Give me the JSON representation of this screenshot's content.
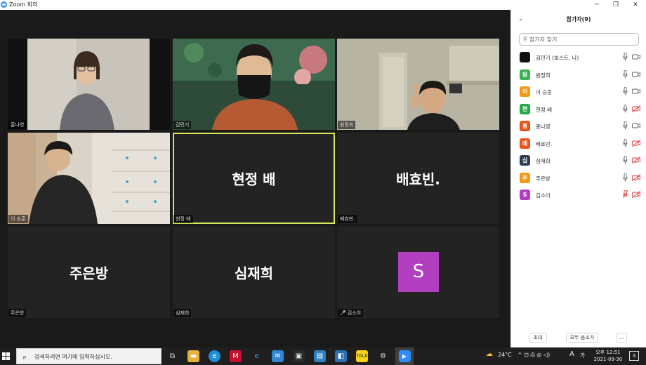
{
  "window": {
    "title": "Zoom 회의",
    "minimize": "─",
    "restore": "❐",
    "close": "✕"
  },
  "tiles": [
    {
      "id": "t1",
      "caption": "홍나영",
      "kind": "video"
    },
    {
      "id": "t2",
      "caption": "김민기",
      "kind": "video"
    },
    {
      "id": "t3",
      "caption": "원정희",
      "kind": "video"
    },
    {
      "id": "t4",
      "caption": "이 승훈",
      "kind": "video"
    },
    {
      "id": "t5",
      "caption": "현정 배",
      "display": "현정 배",
      "kind": "name",
      "active": true
    },
    {
      "id": "t6",
      "caption": "배효빈.",
      "display": "배효빈.",
      "kind": "name"
    },
    {
      "id": "t7",
      "caption": "주은방",
      "display": "주은방",
      "kind": "name"
    },
    {
      "id": "t8",
      "caption": "심재희",
      "display": "심재희",
      "kind": "name"
    },
    {
      "id": "t9",
      "caption": "김소이",
      "display": "S",
      "kind": "avatar",
      "muted": true,
      "avatar_color": "#b23fc0"
    }
  ],
  "panel": {
    "title": "참가자(9)",
    "search_placeholder": "참가자 찾기",
    "participants": [
      {
        "name": "김민기 (호스트, 나)",
        "initial": "",
        "color": "#111111",
        "mic": "on",
        "cam": "on"
      },
      {
        "name": "원정희",
        "initial": "원",
        "color": "#3cb054",
        "mic": "on",
        "cam": "on"
      },
      {
        "name": "이 승훈",
        "initial": "이",
        "color": "#f29a18",
        "mic": "on",
        "cam": "on"
      },
      {
        "name": "현정 배",
        "initial": "현",
        "color": "#26a84b",
        "mic": "on",
        "cam": "off"
      },
      {
        "name": "홍나영",
        "initial": "홍",
        "color": "#e8561b",
        "mic": "on",
        "cam": "on"
      },
      {
        "name": "배효빈.",
        "initial": "배",
        "color": "#e8561b",
        "mic": "on",
        "cam": "off"
      },
      {
        "name": "심재희",
        "initial": "심",
        "color": "#2c3e50",
        "mic": "on",
        "cam": "off"
      },
      {
        "name": "주은방",
        "initial": "주",
        "color": "#f29a18",
        "mic": "on",
        "cam": "off"
      },
      {
        "name": "김소이",
        "initial": "S",
        "color": "#b23fc0",
        "mic": "off",
        "cam": "off"
      }
    ],
    "buttons": {
      "invite": "초대",
      "mute_all": "모두 음소거",
      "more": "..."
    }
  },
  "taskbar": {
    "search_placeholder": "검색하려면 여기에 입력하십시오.",
    "weather": "24°C",
    "tray_icons": "^  ⊡  ⎙  ◎  ◁)",
    "ime_lang": "A",
    "ime_mode": "가",
    "time": "오후 12:51",
    "date": "2021-09-30",
    "notification_count": "3"
  }
}
